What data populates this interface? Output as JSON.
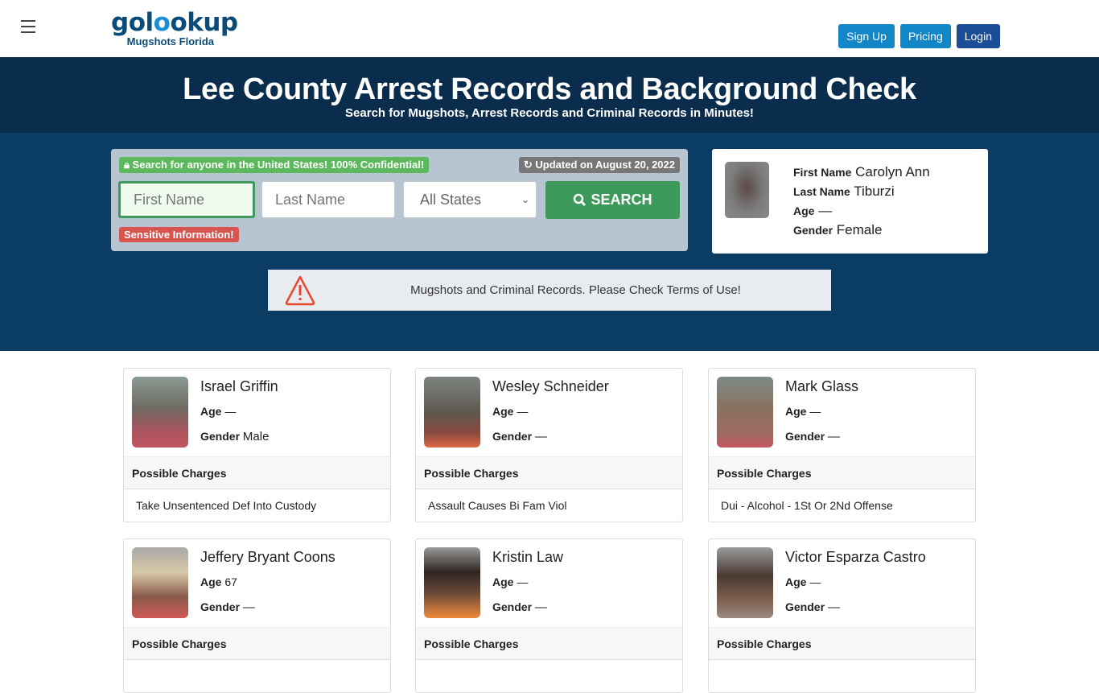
{
  "header": {
    "logo_main_pre": "gol",
    "logo_main_o": "o",
    "logo_main_post": "okup",
    "logo_sub": "Mugshots Florida",
    "buttons": {
      "signup": "Sign Up",
      "pricing": "Pricing",
      "login": "Login"
    }
  },
  "hero": {
    "title": "Lee County Arrest Records and Background Check",
    "subtitle": "Search for Mugshots, Arrest Records and Criminal Records in Minutes!"
  },
  "search": {
    "confidential_badge": "Search for anyone in the United States! 100% Confidential!",
    "updated_badge": "Updated on August 20, 2022",
    "first_name_placeholder": "First Name",
    "last_name_placeholder": "Last Name",
    "state_selected": "All States",
    "search_button": "SEARCH",
    "sensitive_badge": "Sensitive Information!"
  },
  "profile": {
    "first_name_label": "First Name",
    "first_name": "Carolyn Ann",
    "last_name_label": "Last Name",
    "last_name": "Tiburzi",
    "age_label": "Age",
    "age": "—",
    "gender_label": "Gender",
    "gender": "Female"
  },
  "notice": {
    "text": "Mugshots and Criminal Records. Please Check Terms of Use!"
  },
  "records_labels": {
    "age": "Age",
    "gender": "Gender",
    "charges": "Possible Charges"
  },
  "records": [
    {
      "name": "Israel Griffin",
      "age": "—",
      "gender": "Male",
      "charge": "Take Unsentenced Def Into Custody"
    },
    {
      "name": "Wesley Schneider",
      "age": "—",
      "gender": "—",
      "charge": "Assault Causes Bi Fam Viol"
    },
    {
      "name": "Mark Glass",
      "age": "—",
      "gender": "—",
      "charge": "Dui - Alcohol - 1St Or 2Nd Offense"
    },
    {
      "name": "Jeffery Bryant Coons",
      "age": "67",
      "gender": "—",
      "charge": ""
    },
    {
      "name": "Kristin Law",
      "age": "—",
      "gender": "—",
      "charge": ""
    },
    {
      "name": "Victor Esparza Castro",
      "age": "—",
      "gender": "—",
      "charge": ""
    }
  ]
}
